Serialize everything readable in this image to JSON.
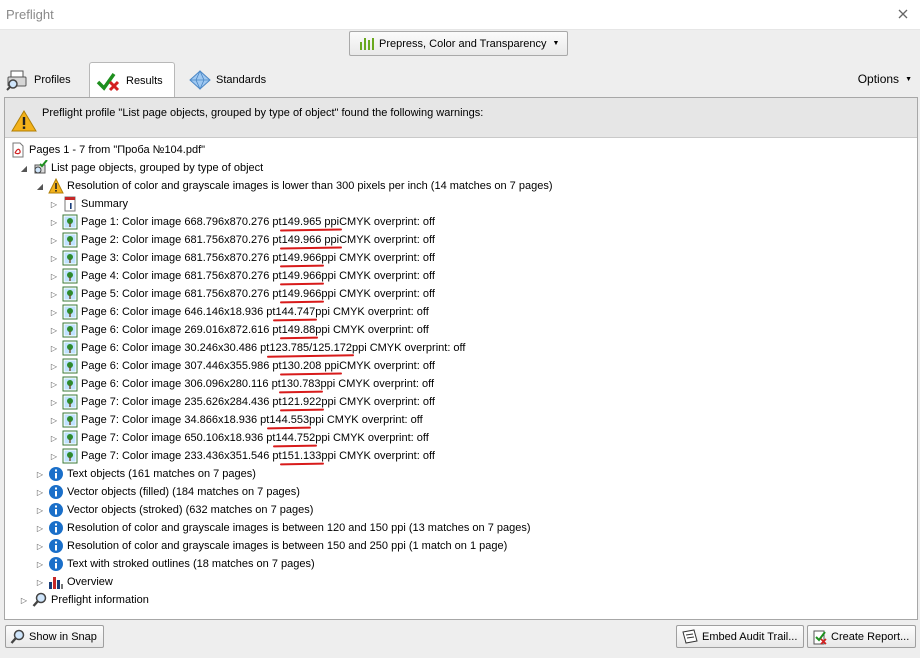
{
  "window": {
    "title": "Preflight"
  },
  "profile_selector": {
    "label": "Prepress, Color and Transparency"
  },
  "tabs": [
    {
      "label": "Profiles"
    },
    {
      "label": "Results"
    },
    {
      "label": "Standards"
    }
  ],
  "options_label": "Options",
  "warning_message": "Preflight profile \"List page objects, grouped by type of object\" found the following warnings:",
  "tree": {
    "root": "Pages 1 - 7 from \"Проба №104.pdf\"",
    "profile_node": "List page objects, grouped by type of object",
    "resolution_node": "Resolution of color and grayscale images is lower than 300 pixels per inch (14 matches on 7 pages)",
    "summary": "Summary",
    "images": [
      {
        "pre": "Page 1: Color image 668.796x870.276 pt ",
        "ppi": "149.965 ppi",
        "post": " CMYK  overprint: off"
      },
      {
        "pre": "Page 2: Color image 681.756x870.276 pt ",
        "ppi": "149.966 ppi",
        "post": " CMYK  overprint: off"
      },
      {
        "pre": "Page 3: Color image 681.756x870.276 pt ",
        "ppi": "149.966",
        "post": " ppi CMYK  overprint: off"
      },
      {
        "pre": "Page 4: Color image 681.756x870.276 pt ",
        "ppi": "149.966",
        "post": " ppi CMYK  overprint: off"
      },
      {
        "pre": "Page 5: Color image 681.756x870.276 pt ",
        "ppi": "149.966",
        "post": " ppi CMYK  overprint: off"
      },
      {
        "pre": "Page 6: Color image 646.146x18.936 pt ",
        "ppi": "144.747",
        "post": " ppi CMYK  overprint: off"
      },
      {
        "pre": "Page 6: Color image 269.016x872.616 pt ",
        "ppi": "149.88",
        "post": " ppi CMYK  overprint: off"
      },
      {
        "pre": "Page 6: Color image 30.246x30.486 pt ",
        "ppi": "123.785/125.172",
        "post": " ppi CMYK  overprint: off"
      },
      {
        "pre": "Page 6: Color image 307.446x355.986 pt ",
        "ppi": "130.208 ppi",
        "post": " CMYK  overprint: off"
      },
      {
        "pre": "Page 6: Color image 306.096x280.116 pt ",
        "ppi": "130.783",
        "post": " ppi CMYK  overprint: off"
      },
      {
        "pre": "Page 7: Color image 235.626x284.436 pt ",
        "ppi": "121.922",
        "post": " ppi CMYK  overprint: off"
      },
      {
        "pre": "Page 7: Color image 34.866x18.936 pt ",
        "ppi": "144.553",
        "post": " ppi CMYK  overprint: off"
      },
      {
        "pre": "Page 7: Color image 650.106x18.936 pt ",
        "ppi": "144.752",
        "post": " ppi CMYK  overprint: off"
      },
      {
        "pre": "Page 7: Color image 233.436x351.546 pt ",
        "ppi": "151.133",
        "post": " ppi CMYK  overprint: off"
      }
    ],
    "other_nodes": [
      "Text objects (161 matches on 7 pages)",
      "Vector objects (filled) (184 matches on 7 pages)",
      "Vector objects (stroked) (632 matches on 7 pages)",
      "Resolution of color and grayscale images is between 120 and 150 ppi (13 matches on 7 pages)",
      "Resolution of color and grayscale images is between 150 and 250 ppi (1 match on 1 page)",
      "Text with stroked outlines (18 matches on 7 pages)"
    ],
    "overview": "Overview",
    "preflight_info": "Preflight information"
  },
  "buttons": {
    "show_in_snap": "Show in Snap",
    "embed_audit_trail": "Embed Audit Trail...",
    "create_report": "Create Report..."
  },
  "colors": {
    "underline": "#d81b1b",
    "info_icon": "#1a6fc9",
    "warning_icon": "#f3b21b"
  }
}
